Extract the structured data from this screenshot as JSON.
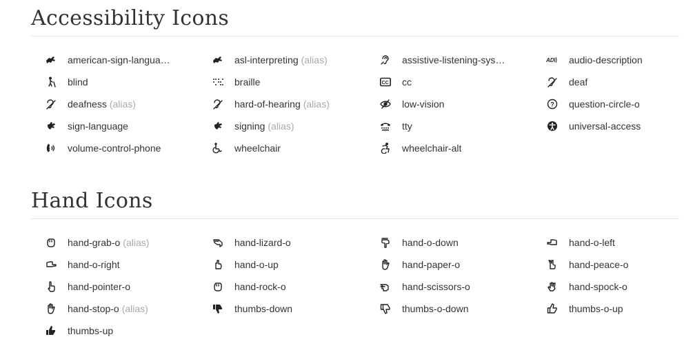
{
  "accessibility": {
    "title": "Accessibility Icons",
    "items": [
      {
        "label": "american-sign-languag...",
        "icon": "asl-icon",
        "alias": ""
      },
      {
        "label": "asl-interpreting",
        "icon": "asl-icon",
        "alias": "(alias)"
      },
      {
        "label": "assistive-listening-syste...",
        "icon": "assistive-listening-icon",
        "alias": ""
      },
      {
        "label": "audio-description",
        "icon": "audio-description-icon",
        "alias": ""
      },
      {
        "label": "blind",
        "icon": "blind-icon",
        "alias": ""
      },
      {
        "label": "braille",
        "icon": "braille-icon",
        "alias": ""
      },
      {
        "label": "cc",
        "icon": "cc-icon",
        "alias": ""
      },
      {
        "label": "deaf",
        "icon": "deaf-icon",
        "alias": ""
      },
      {
        "label": "deafness",
        "icon": "deaf-icon",
        "alias": "(alias)"
      },
      {
        "label": "hard-of-hearing",
        "icon": "deaf-icon",
        "alias": "(alias)"
      },
      {
        "label": "low-vision",
        "icon": "low-vision-icon",
        "alias": ""
      },
      {
        "label": "question-circle-o",
        "icon": "question-circle-icon",
        "alias": ""
      },
      {
        "label": "sign-language",
        "icon": "sign-language-icon",
        "alias": ""
      },
      {
        "label": "signing",
        "icon": "sign-language-icon",
        "alias": "(alias)"
      },
      {
        "label": "tty",
        "icon": "tty-icon",
        "alias": ""
      },
      {
        "label": "universal-access",
        "icon": "universal-access-icon",
        "alias": ""
      },
      {
        "label": "volume-control-phone",
        "icon": "volume-control-phone-icon",
        "alias": ""
      },
      {
        "label": "wheelchair",
        "icon": "wheelchair-icon",
        "alias": ""
      },
      {
        "label": "wheelchair-alt",
        "icon": "wheelchair-alt-icon",
        "alias": ""
      }
    ]
  },
  "hand": {
    "title": "Hand Icons",
    "items": [
      {
        "label": "hand-grab-o",
        "icon": "hand-rock-icon",
        "alias": "(alias)"
      },
      {
        "label": "hand-lizard-o",
        "icon": "hand-lizard-icon",
        "alias": ""
      },
      {
        "label": "hand-o-down",
        "icon": "hand-down-icon",
        "alias": ""
      },
      {
        "label": "hand-o-left",
        "icon": "hand-left-icon",
        "alias": ""
      },
      {
        "label": "hand-o-right",
        "icon": "hand-right-icon",
        "alias": ""
      },
      {
        "label": "hand-o-up",
        "icon": "hand-up-icon",
        "alias": ""
      },
      {
        "label": "hand-paper-o",
        "icon": "hand-paper-icon",
        "alias": ""
      },
      {
        "label": "hand-peace-o",
        "icon": "hand-peace-icon",
        "alias": ""
      },
      {
        "label": "hand-pointer-o",
        "icon": "hand-pointer-icon",
        "alias": ""
      },
      {
        "label": "hand-rock-o",
        "icon": "hand-rock-icon",
        "alias": ""
      },
      {
        "label": "hand-scissors-o",
        "icon": "hand-scissors-icon",
        "alias": ""
      },
      {
        "label": "hand-spock-o",
        "icon": "hand-spock-icon",
        "alias": ""
      },
      {
        "label": "hand-stop-o",
        "icon": "hand-paper-icon",
        "alias": "(alias)"
      },
      {
        "label": "thumbs-down",
        "icon": "thumbs-down-icon",
        "alias": ""
      },
      {
        "label": "thumbs-o-down",
        "icon": "thumbs-o-down-icon",
        "alias": ""
      },
      {
        "label": "thumbs-o-up",
        "icon": "thumbs-o-up-icon",
        "alias": ""
      },
      {
        "label": "thumbs-up",
        "icon": "thumbs-up-icon",
        "alias": ""
      }
    ]
  },
  "colors": {
    "text": "#333333",
    "alias": "#aaaaaa",
    "rule": "#e6e6e6"
  }
}
